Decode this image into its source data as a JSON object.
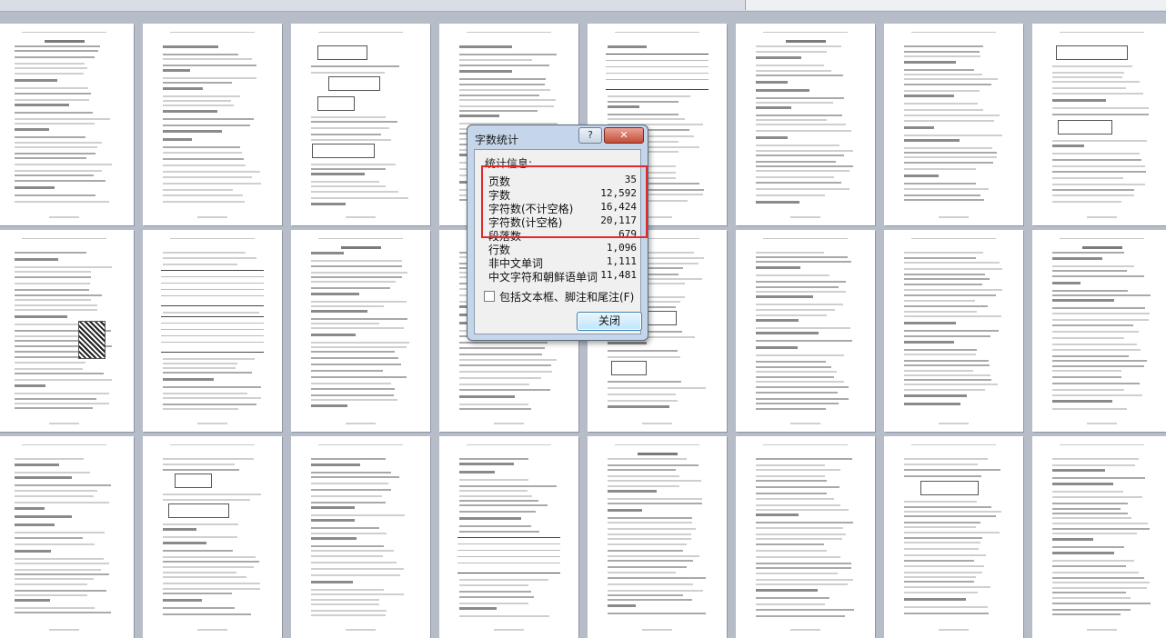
{
  "dialog": {
    "title": "字数统计",
    "help_label": "?",
    "close_glyph": "✕",
    "group_label": "统计信息:",
    "stats": [
      {
        "label": "页数",
        "value": "35"
      },
      {
        "label": "字数",
        "value": "12,592"
      },
      {
        "label": "字符数(不计空格)",
        "value": "16,424"
      },
      {
        "label": "字符数(计空格)",
        "value": "20,117"
      },
      {
        "label": "段落数",
        "value": "679"
      },
      {
        "label": "行数",
        "value": "1,096"
      },
      {
        "label": "非中文单词",
        "value": "1,111"
      },
      {
        "label": "中文字符和朝鲜语单词",
        "value": "11,481"
      }
    ],
    "checkbox_label": "包括文本框、脚注和尾注(F)",
    "checkbox_checked": false,
    "close_button_label": "关闭"
  },
  "document_pages": {
    "rows": 3,
    "columns": 8
  },
  "colors": {
    "highlight": "#e32a2a",
    "workspace": "#b6bcc8"
  }
}
